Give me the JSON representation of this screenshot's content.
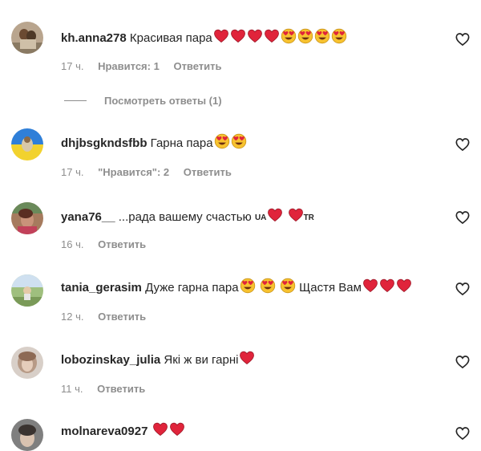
{
  "comments": [
    {
      "username": "kh.anna278",
      "text": "Красивая пара",
      "emoji": [
        "heart",
        "heart",
        "heart",
        "heart",
        "heart-eyes",
        "heart-eyes",
        "heart-eyes",
        "heart-eyes"
      ],
      "time": "17 ч.",
      "likes_label": "Нравится: 1",
      "reply_label": "Ответить",
      "view_replies_label": "Посмотреть ответы (1)"
    },
    {
      "username": "dhjbsgkndsfbb",
      "text": "Гарна пара",
      "emoji": [
        "heart-eyes",
        "heart-eyes"
      ],
      "time": "17 ч.",
      "likes_label": "\"Нравится\": 2",
      "reply_label": "Ответить"
    },
    {
      "username": "yana76__",
      "text": "...рада вашему счастью",
      "flag1": "UA",
      "flag2": "TR",
      "emoji": [
        "heart",
        "heart"
      ],
      "time": "16 ч.",
      "reply_label": "Ответить"
    },
    {
      "username": "tania_gerasim",
      "text": "Дуже гарна пара",
      "text2": "Щастя Вам",
      "emoji": [
        "heart-eyes",
        "heart-eyes",
        "heart-eyes",
        "heart",
        "heart",
        "heart"
      ],
      "time": "12 ч.",
      "reply_label": "Ответить"
    },
    {
      "username": "lobozinskay_julia",
      "text": "Які ж ви гарні",
      "emoji": [
        "heart"
      ],
      "time": "11 ч.",
      "reply_label": "Ответить"
    },
    {
      "username": "molnareva0927",
      "text": "",
      "emoji": [
        "heart",
        "heart"
      ]
    }
  ],
  "icons": {
    "like": "heart-outline-icon"
  },
  "colors": {
    "secondary": "#8e8e8e",
    "heart": "#e0243b",
    "emoji_face": "#f7c22f"
  }
}
